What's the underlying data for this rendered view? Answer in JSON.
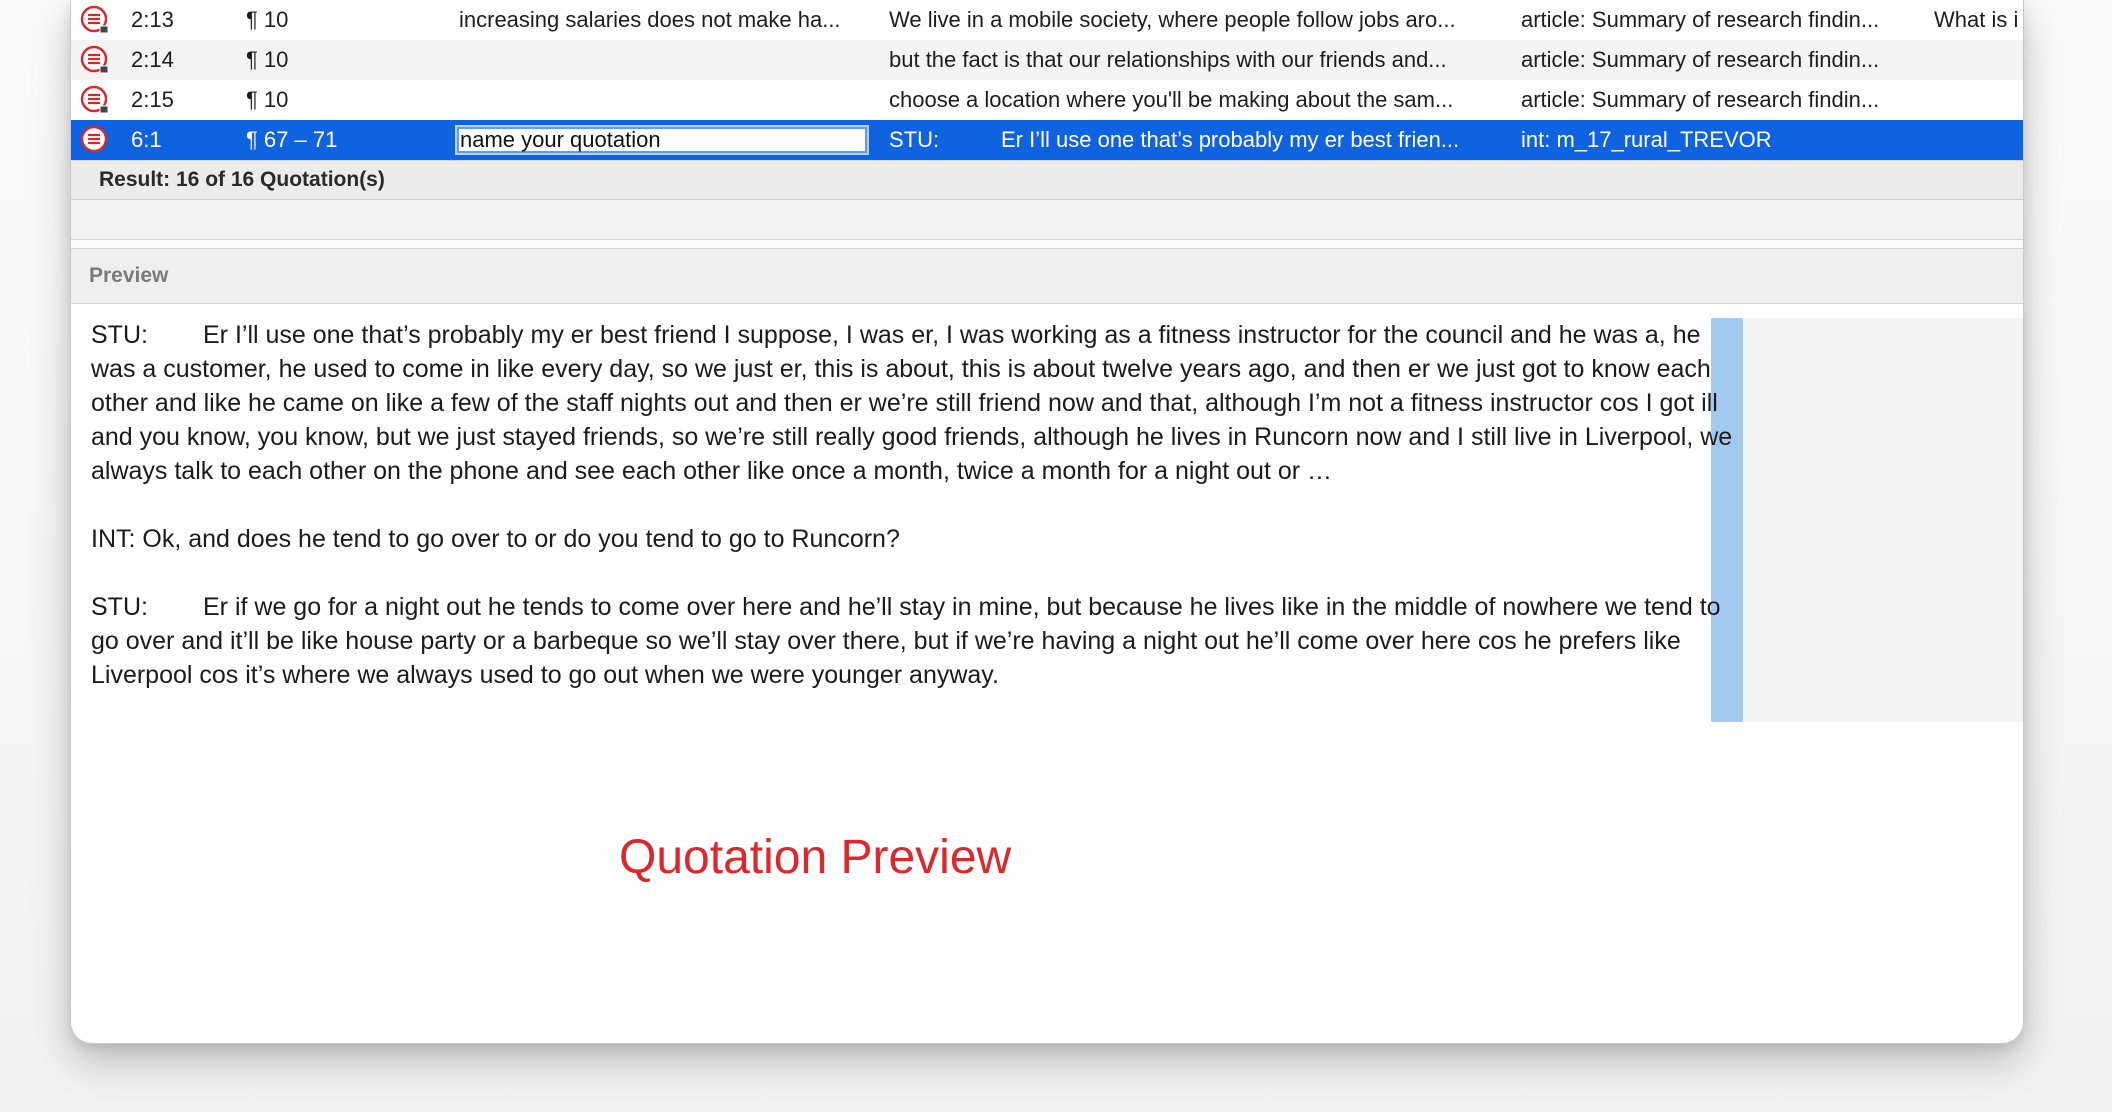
{
  "table": {
    "rows": [
      {
        "id": "2:13",
        "para": "¶ 10",
        "name": "increasing salaries does not make ha...",
        "text": "We live in a mobile society, where people follow jobs aro...",
        "document": "article: Summary of research findin...",
        "comment": "What is i"
      },
      {
        "id": "2:14",
        "para": "¶ 10",
        "name": "",
        "text": "but the fact is that our relationships with our friends and...",
        "document": "article: Summary of research findin...",
        "comment": ""
      },
      {
        "id": "2:15",
        "para": "¶ 10",
        "name": "",
        "text": "choose a location where you'll be making about the sam...",
        "document": "article: Summary of research findin...",
        "comment": ""
      }
    ],
    "selected": {
      "id": "6:1",
      "para": "¶ 67 – 71",
      "name_value": "name your quotation",
      "text_speaker": "STU:",
      "text": "Er I’ll use one that’s probably my er best frien...",
      "document": "int: m_17_rural_TREVOR"
    },
    "icon": "quotation-icon"
  },
  "result": {
    "label": "Result: 16 of 16 Quotation(s)"
  },
  "preview": {
    "title": "Preview",
    "paragraphs": [
      {
        "speaker": "STU:",
        "text": "Er I’ll use one that’s probably my er best friend I suppose, I was er, I was working as a fitness instructor for the council and he was a, he was a customer, he used to come in like every day, so we just er, this is about, this is about twelve years ago, and then er we just got to know each other and like he came on like a few of the staff nights out and then er we’re still friend now and that, although I’m not a fitness instructor cos I got ill and you know, you know, but we just stayed friends, so we’re still really good friends, although he lives in Runcorn now and I still live in Liverpool, we always talk to each other on the phone and see each other like once a month, twice a month for a night out or …"
      },
      {
        "speaker": "",
        "text": "INT: Ok, and does he tend to go over to  or do you tend to go to Runcorn?"
      },
      {
        "speaker": "STU:",
        "text": "Er if we go for a night out he tends to come over here and he’ll stay in mine, but because he lives like in the middle of nowhere we tend to go over and it’ll be like house party or a barbeque so we’ll stay over there, but if we’re having a night out he’ll come over here cos he prefers like Liverpool cos it’s where we always used to go out when we were younger anyway."
      }
    ]
  },
  "caption": "Quotation Preview",
  "colors": {
    "selection": "#0f62e0",
    "icon_red": "#d9262b",
    "margin_bar": "#a3c9f1",
    "caption": "#e0262b"
  }
}
